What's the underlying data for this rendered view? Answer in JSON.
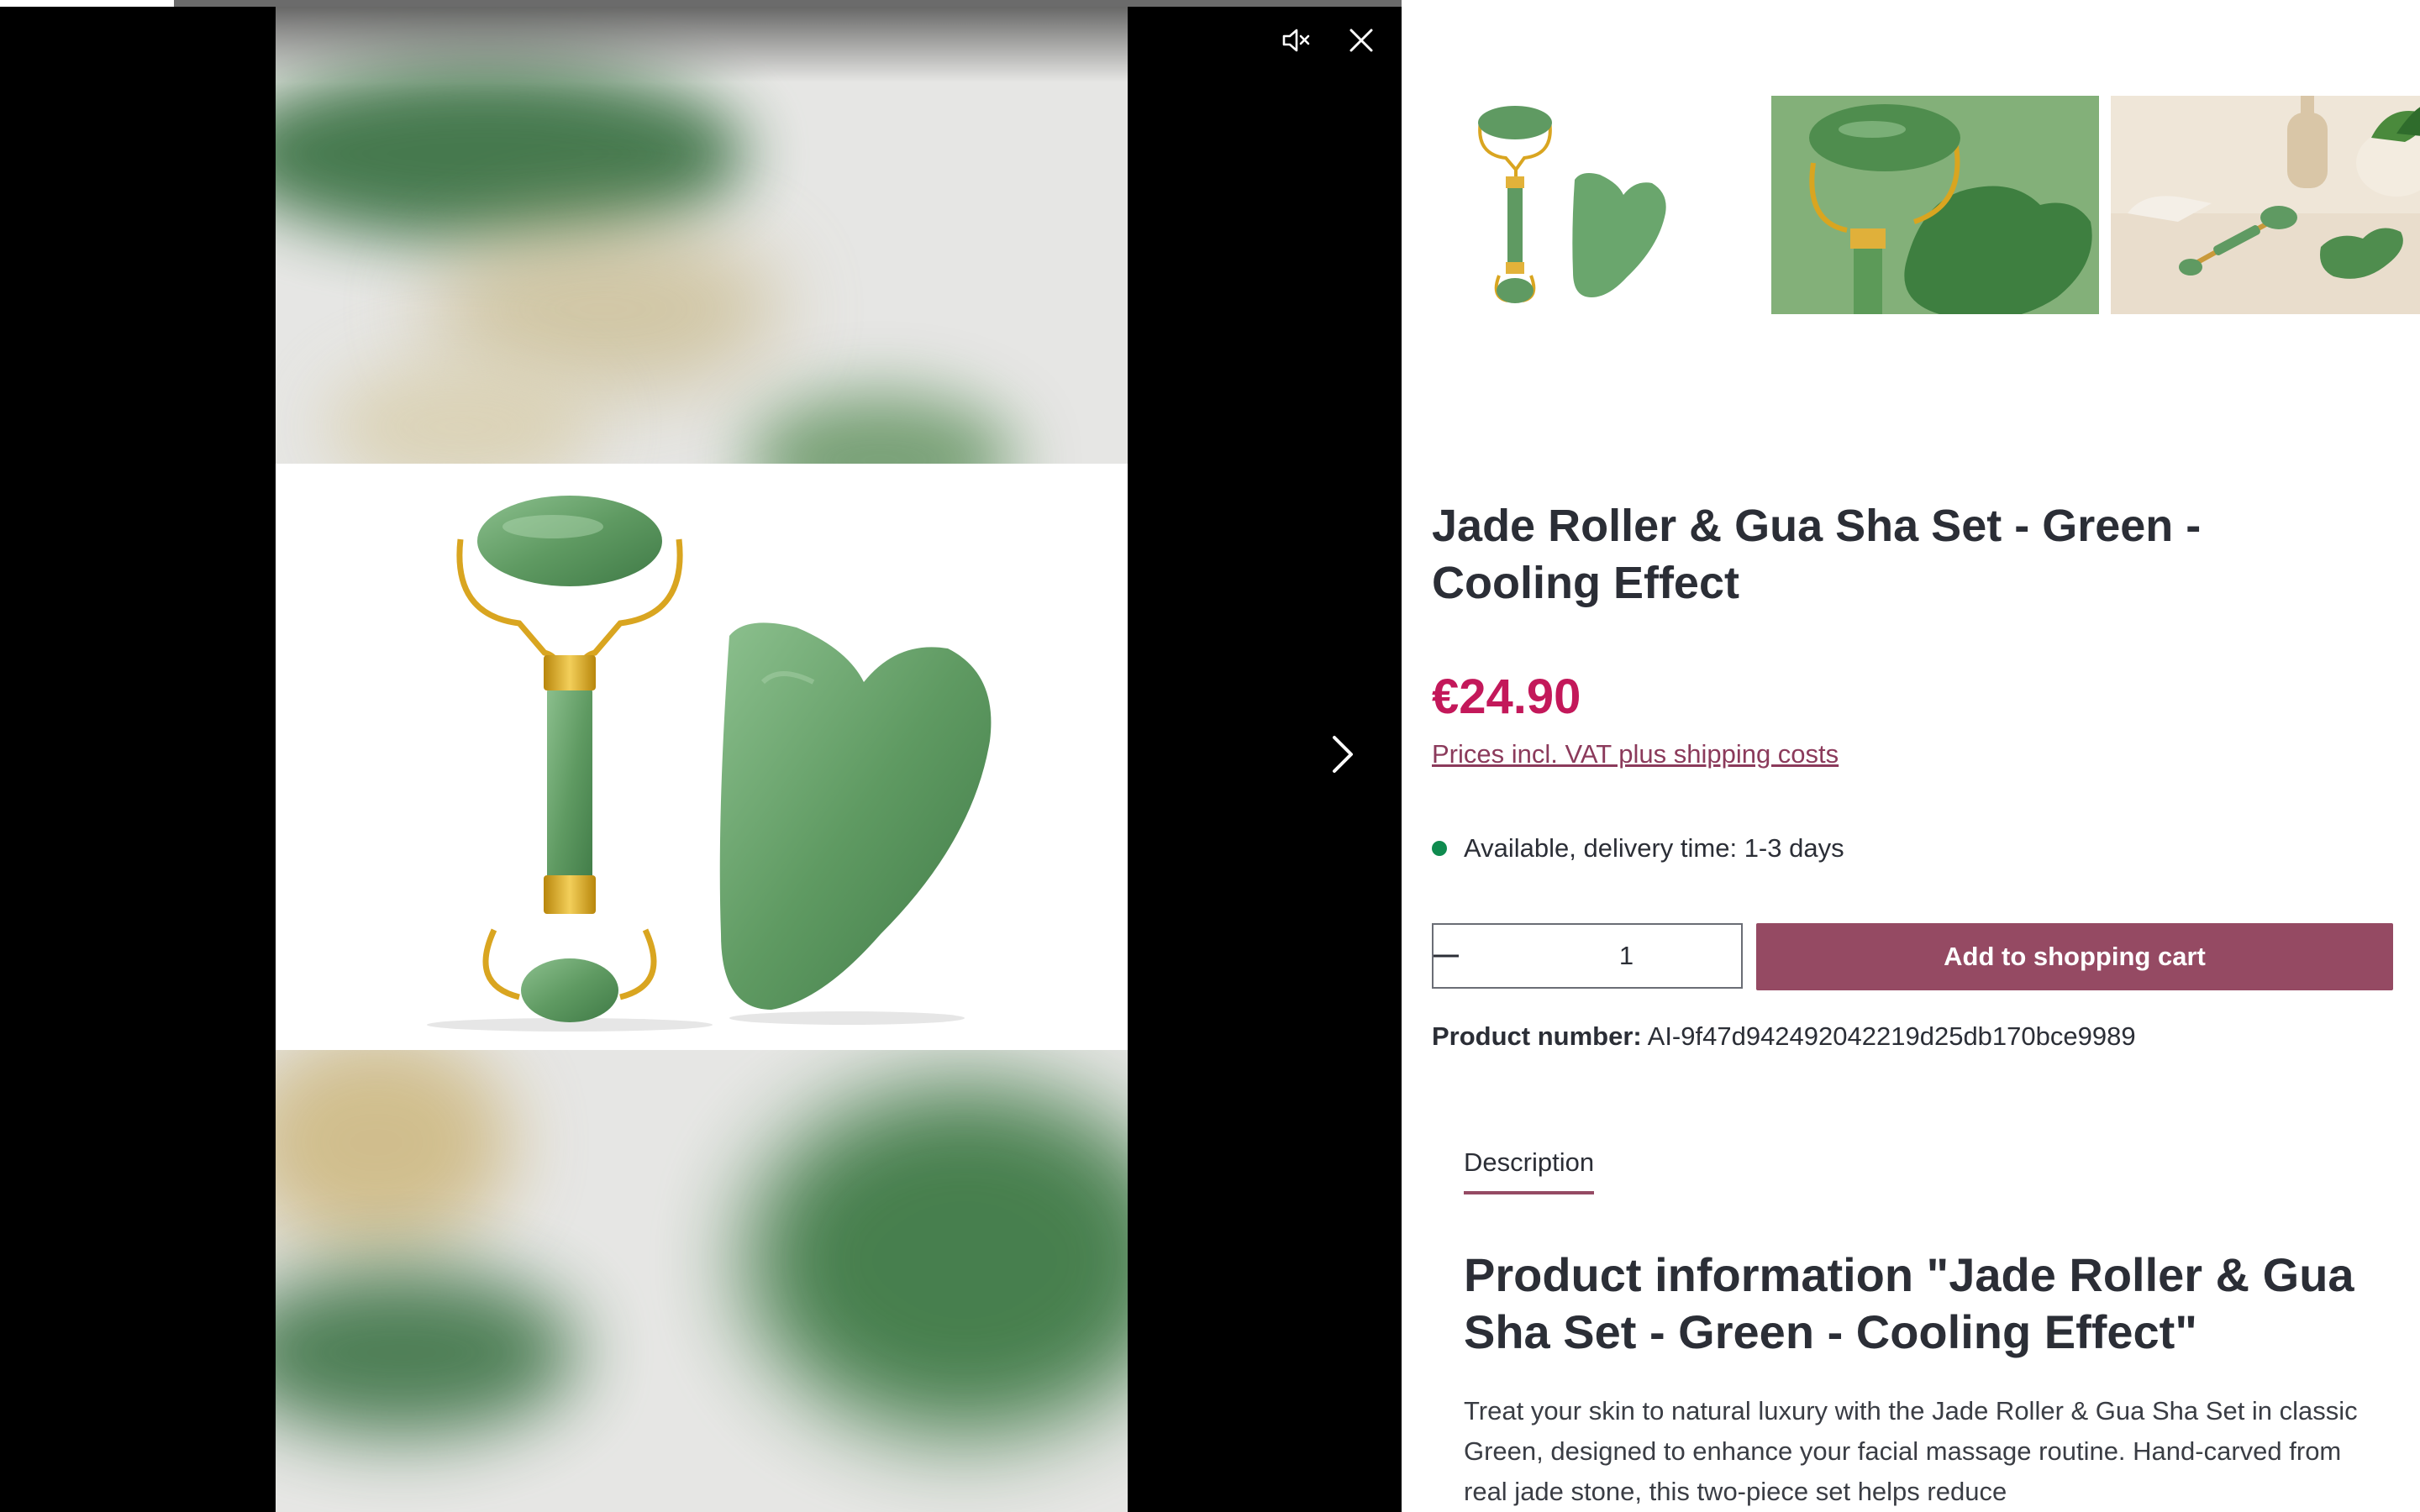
{
  "viewer": {
    "progress": 0.124,
    "mute_icon": "volume-muted-icon",
    "close_icon": "close-icon",
    "next_icon": "chevron-right-icon"
  },
  "gallery": {
    "thumbnails": [
      {
        "label": "jade roller and gua sha on white background"
      },
      {
        "label": "jade roller and gua sha close-up on green surface"
      },
      {
        "label": "jade roller and gua sha on beige table with vase"
      }
    ]
  },
  "product": {
    "title": "Jade Roller & Gua Sha Set - Green - Cooling Effect",
    "price": "€24.90",
    "vat_link": "Prices incl. VAT plus shipping costs",
    "availability": "Available, delivery time: 1-3 days",
    "availability_color": "#0f8b4f",
    "quantity": "1",
    "add_to_cart": "Add to shopping cart",
    "product_number_label": "Product number:",
    "product_number": "AI-9f47d942492042219d25db170bce9989"
  },
  "tabs": [
    {
      "label": "Description"
    }
  ],
  "description": {
    "heading": "Product information \"Jade Roller & Gua Sha Set - Green - Cooling Effect\"",
    "text": "Treat your skin to natural luxury with the Jade Roller & Gua Sha Set in classic Green, designed to enhance your facial massage routine. Hand-carved from real jade stone, this two-piece set helps reduce"
  },
  "colors": {
    "accent": "#954a63",
    "price": "#c3185a",
    "link": "#8b3a5b",
    "jade": "#5f9a62"
  }
}
